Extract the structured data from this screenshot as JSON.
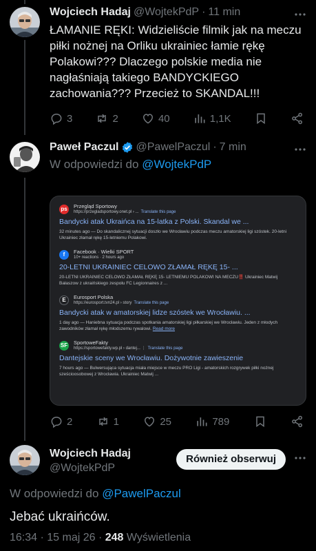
{
  "tweet1": {
    "name": "Wojciech Hadaj",
    "handle": "@WojtekPdP",
    "dot": "·",
    "time": "11 min",
    "text": "ŁAMANIE RĘKI: Widzieliście filmik jak na meczu piłki nożnej na Orliku ukrainiec łamie rękę Polakowi??? Dlaczego polskie media nie nagłaśniają takiego BANDYCKIEGO zachowania??? Przecież to SKANDAL!!!",
    "replies": "3",
    "reposts": "2",
    "likes": "40",
    "views": "1,1K"
  },
  "tweet2": {
    "name": "Paweł Paczul",
    "handle": "@PawelPaczul",
    "dot": "·",
    "time": "7 min",
    "reply_prefix": "W odpowiedzi do",
    "reply_to": "@WojtekPdP",
    "replies": "2",
    "reposts": "1",
    "likes": "25",
    "views": "789",
    "search_results": [
      {
        "source": "Przegląd Sportowy",
        "url": "https://przegladsportowy.onet.pl › ...",
        "translate": "Translate this page",
        "title": "Bandycki atak Ukraińca na 15-latka z Polski. Skandal we ...",
        "snippet": "32 minutes ago — Do skandalicznej sytuacji doszło we Wrocławiu podczas meczu amatorskiej ligi szóstek. 20-letni Ukrainiec złamał rękę 15-letniemu Polakowi."
      },
      {
        "source": "Facebook · Wielki SPORT",
        "url": "10+ reactions · 2 hours ago",
        "translate": "",
        "title": "20-LETNI UKRAINIEC CELOWO ZŁAMAŁ RĘKĘ 15- ...",
        "snippet": "20-LETNI UKRAINIEC CELOWO ZŁAMAŁ RĘKĘ 15- LETNIEMU POLAKOWI NA MECZU‼️ Ukrainiec Matwij Bałaszow z ukraińskiego zespołu FC Legionnaires z ..."
      },
      {
        "source": "Eurosport Polska",
        "url": "https://eurosport.tvn24.pl › story",
        "translate": "Translate this page",
        "title": "Bandycki atak w amatorskiej lidze szóstek we Wrocławiu. ...",
        "snippet": "1 day ago — Haniebna sytuacja podczas spotkania amatorskiej ligi piłkarskiej we Wrocławiu. Jeden z młodych zawodników złamał rękę młodszemu rywalowi.",
        "read_more": "Read more"
      },
      {
        "source": "SportoweFakty",
        "url": "https://sportowefakty.wp.pl › dantej... ⋮",
        "translate": "Translate this page",
        "title": "Dantejskie sceny we Wrocławiu. Dożywotnie zawieszenie",
        "snippet": "7 hours ago — Bulwersująca sytuacja miała miejsce w meczu PRO Ligi - amatorskich rozgrywek piłki nożnej sześcioosobowej z Wrocławia. Ukrainiec Matwij ..."
      }
    ]
  },
  "tweet3": {
    "name": "Wojciech Hadaj",
    "handle": "@WojtekPdP",
    "follow_label": "Również obserwuj",
    "reply_prefix": "W odpowiedzi do",
    "reply_to": "@PawelPaczul",
    "text": "Jebać ukraińców.",
    "timestamp": "16:34 · 15 maj 26 ·",
    "views_count": "248",
    "views_label": "Wyświetlenia"
  },
  "more_icon": "more-icon",
  "colors": {
    "background": "#000000",
    "accent": "#1d9bf0",
    "muted": "#71767b",
    "text": "#e7e9ea"
  }
}
